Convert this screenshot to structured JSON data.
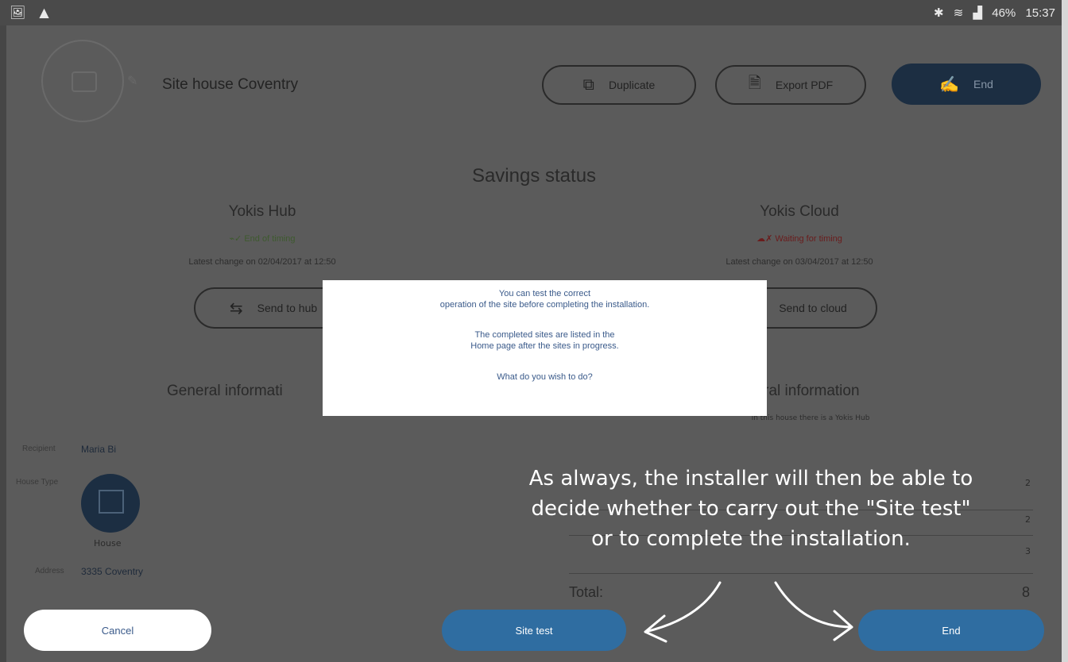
{
  "statusbar": {
    "left_icons": "🖼 ▲",
    "bluetooth": "✱",
    "wifi": "≋",
    "signal": "▟",
    "battery": "46%",
    "time": "15:37"
  },
  "header": {
    "site_title": "Site house Coventry",
    "duplicate_label": "Duplicate",
    "export_label": "Export PDF",
    "end_label": "End"
  },
  "savings": {
    "title": "Savings status",
    "hub": {
      "title": "Yokis Hub",
      "state": "End of timing",
      "latest": "Latest change on 02/04/2017 at 12:50",
      "send_label": "Send to hub"
    },
    "cloud": {
      "title": "Yokis Cloud",
      "state": "Waiting for timing",
      "latest": "Latest change on 03/04/2017 at 12:50",
      "send_label": "Send to cloud"
    }
  },
  "general_left": {
    "title": "General informati",
    "recipient_label": "Recipient",
    "recipient_value": "Maria Bi",
    "house_type_label": "House Type",
    "house_label": "House",
    "address_label": "Address",
    "address_value": "3335 Coventry"
  },
  "general_right": {
    "title": "neral information",
    "subtitle": "In this house there is a Yokis Hub",
    "rows": [
      "2",
      "2",
      "3"
    ],
    "total_label": "Total:",
    "total_value": "8"
  },
  "dialog": {
    "line1": "You can test the correct",
    "line2": "operation of the site before completing the installation.",
    "line3": "The completed sites are listed in the",
    "line4": "Home page after the sites in progress.",
    "question": "What do you wish to do?"
  },
  "actions": {
    "cancel_label": "Cancel",
    "site_test_label": "Site test",
    "end_label": "End"
  },
  "annotation": {
    "line1": "As always, the installer will then be able to",
    "line2": "decide whether to carry out the \"Site test\"",
    "line3": "or to complete the installation."
  },
  "colors": {
    "overlay": "#5b5b5b",
    "navy": "#1c2e42",
    "action_blue": "#2f6da1",
    "dialog_text": "#3a5a8a"
  }
}
